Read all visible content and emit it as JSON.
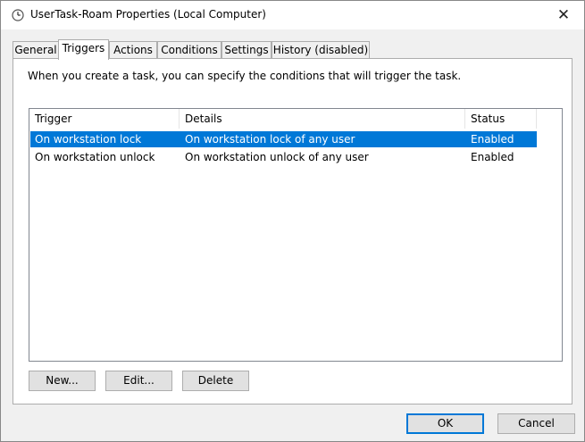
{
  "window": {
    "title": "UserTask-Roam Properties (Local Computer)",
    "close_symbol": "✕"
  },
  "tabs": [
    {
      "label": "General",
      "active": false
    },
    {
      "label": "Triggers",
      "active": true
    },
    {
      "label": "Actions",
      "active": false
    },
    {
      "label": "Conditions",
      "active": false
    },
    {
      "label": "Settings",
      "active": false
    },
    {
      "label": "History (disabled)",
      "active": false
    }
  ],
  "triggers_panel": {
    "instruction": "When you create a task, you can specify the conditions that will trigger the task.",
    "columns": [
      "Trigger",
      "Details",
      "Status"
    ],
    "rows": [
      {
        "trigger": "On workstation lock",
        "details": "On workstation lock of any user",
        "status": "Enabled",
        "selected": true
      },
      {
        "trigger": "On workstation unlock",
        "details": "On workstation unlock of any user",
        "status": "Enabled",
        "selected": false
      }
    ],
    "buttons": {
      "new": "New...",
      "edit": "Edit...",
      "delete": "Delete"
    }
  },
  "dialog_buttons": {
    "ok": "OK",
    "cancel": "Cancel"
  },
  "colors": {
    "selection": "#0078d7",
    "window_bg": "#f0f0f0",
    "panel_bg": "#ffffff"
  },
  "icons": {
    "title": "clock-icon",
    "close": "close-icon"
  }
}
